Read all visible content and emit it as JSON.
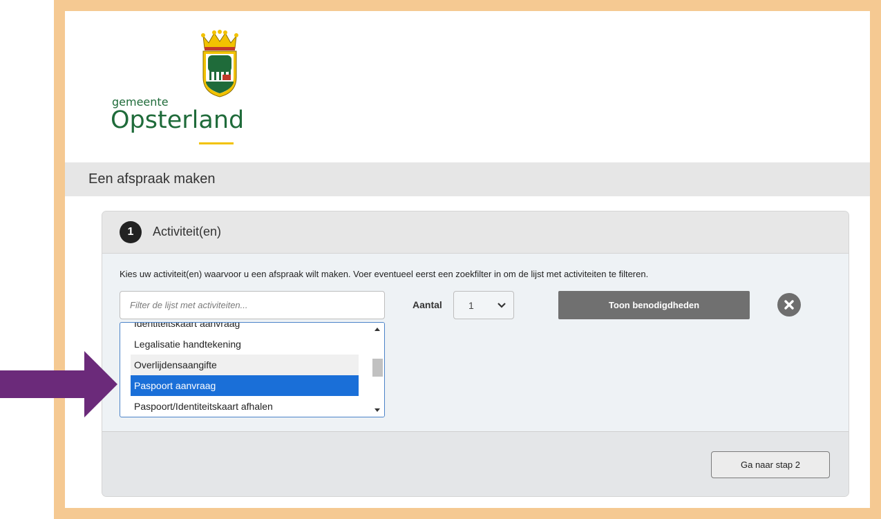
{
  "logo": {
    "prefix": "gemeente",
    "name": "Opsterland"
  },
  "page_title": "Een afspraak maken",
  "step": {
    "number": "1",
    "title": "Activiteit(en)",
    "intro": "Kies uw activiteit(en) waarvoor u een afspraak wilt maken. Voer eventueel eerst een zoekfilter in om de lijst met activiteiten te filteren."
  },
  "filter": {
    "placeholder": "Filter de lijst met activiteiten...",
    "value": ""
  },
  "aantal": {
    "label": "Aantal",
    "selected": "1"
  },
  "toon_button": "Toon benodigdheden",
  "activities": [
    {
      "label": "Identiteitskaart aanvraag",
      "state": "partial"
    },
    {
      "label": "Legalisatie handtekening",
      "state": "normal"
    },
    {
      "label": "Overlijdensaangifte",
      "state": "hover"
    },
    {
      "label": "Paspoort aanvraag",
      "state": "selected"
    },
    {
      "label": "Paspoort/Identiteitskaart afhalen",
      "state": "normal"
    }
  ],
  "next_button": "Ga naar stap 2",
  "colors": {
    "frame": "#f5c992",
    "brand_green": "#1f6b3a",
    "selected": "#1a6fd8",
    "arrow": "#6b2a7a"
  },
  "icons": [
    "crest-icon",
    "chevron-down-icon",
    "close-icon",
    "arrow-right-icon"
  ]
}
